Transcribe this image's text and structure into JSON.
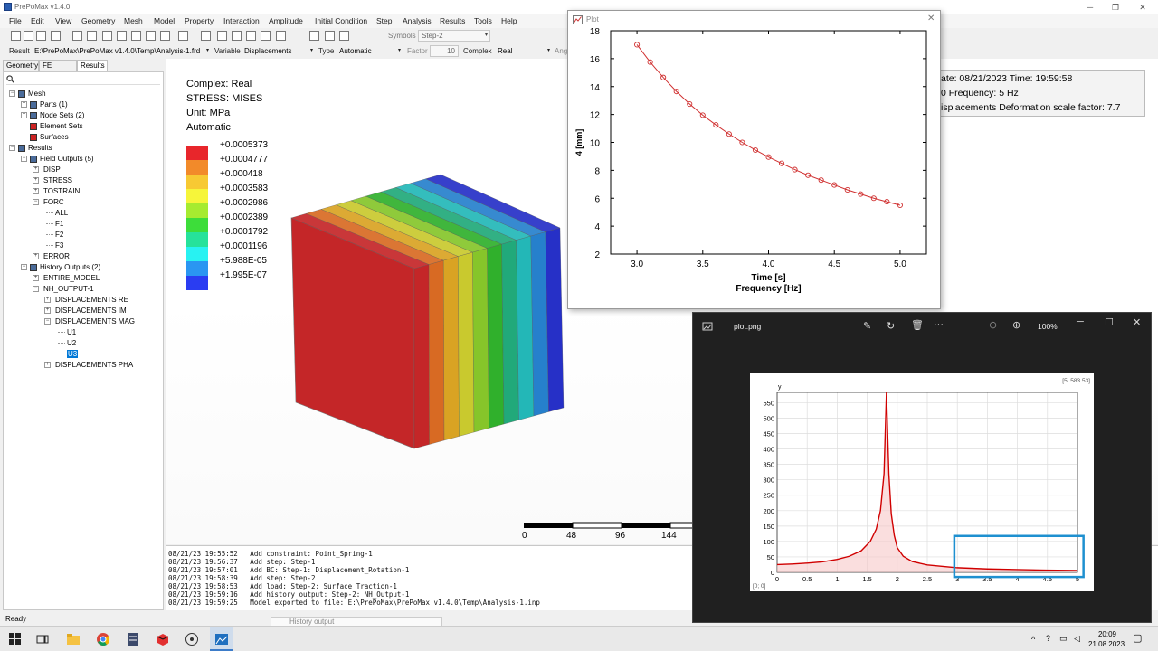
{
  "app": {
    "title": "PrePoMax v1.4.0"
  },
  "menu": [
    "File",
    "Edit",
    "View",
    "Geometry",
    "Mesh",
    "Model",
    "Property",
    "Interaction",
    "Amplitude",
    "Initial Condition",
    "Step",
    "Analysis",
    "Results",
    "Tools",
    "Help"
  ],
  "toolbar": {
    "symbols_label": "Symbols",
    "symbols_value": "Step-2",
    "result_label": "Result",
    "result_path": "E:\\PrePoMax\\PrePoMax v1.4.0\\Temp\\Analysis-1.frd",
    "variable_label": "Variable",
    "variable_value": "Displacements",
    "type_label": "Type",
    "type_value": "Automatic",
    "factor_label": "Factor",
    "factor_value": "10",
    "complex_label": "Complex",
    "complex_value": "Real",
    "angle_label": "Ang"
  },
  "tabs": [
    "Geometry",
    "FE Model",
    "Results"
  ],
  "tree": [
    {
      "label": "Mesh",
      "level": 0,
      "exp": "−"
    },
    {
      "label": "Parts (1)",
      "level": 1,
      "exp": "+"
    },
    {
      "label": "Node Sets (2)",
      "level": 1,
      "exp": "+"
    },
    {
      "label": "Element Sets",
      "level": 1,
      "exp": ""
    },
    {
      "label": "Surfaces",
      "level": 1,
      "exp": ""
    },
    {
      "label": "Results",
      "level": 0,
      "exp": "−"
    },
    {
      "label": "Field Outputs (5)",
      "level": 1,
      "exp": "−"
    },
    {
      "label": "DISP",
      "level": 2,
      "exp": "+"
    },
    {
      "label": "STRESS",
      "level": 2,
      "exp": "+"
    },
    {
      "label": "TOSTRAIN",
      "level": 2,
      "exp": "+"
    },
    {
      "label": "FORC",
      "level": 2,
      "exp": "−"
    },
    {
      "label": "ALL",
      "level": 3,
      "exp": ""
    },
    {
      "label": "F1",
      "level": 3,
      "exp": ""
    },
    {
      "label": "F2",
      "level": 3,
      "exp": ""
    },
    {
      "label": "F3",
      "level": 3,
      "exp": ""
    },
    {
      "label": "ERROR",
      "level": 2,
      "exp": "+"
    },
    {
      "label": "History Outputs (2)",
      "level": 1,
      "exp": "−"
    },
    {
      "label": "ENTIRE_MODEL",
      "level": 2,
      "exp": "+"
    },
    {
      "label": "NH_OUTPUT-1",
      "level": 2,
      "exp": "−"
    },
    {
      "label": "DISPLACEMENTS RE",
      "level": 3,
      "exp": "+"
    },
    {
      "label": "DISPLACEMENTS IM",
      "level": 3,
      "exp": "+"
    },
    {
      "label": "DISPLACEMENTS MAG",
      "level": 3,
      "exp": "−"
    },
    {
      "label": "U1",
      "level": 4,
      "exp": ""
    },
    {
      "label": "U2",
      "level": 4,
      "exp": ""
    },
    {
      "label": "U3",
      "level": 4,
      "exp": "",
      "selected": true
    },
    {
      "label": "DISPLACEMENTS PHA",
      "level": 3,
      "exp": "+"
    }
  ],
  "legend": {
    "complex": "Complex: Real",
    "stress": "STRESS: MISES",
    "unit": "Unit: MPa",
    "mode": "Automatic",
    "values": [
      "+0.0005373",
      "+0.0004777",
      "+0.000418",
      "+0.0003583",
      "+0.0002986",
      "+0.0002389",
      "+0.0001792",
      "+0.0001196",
      "+5.988E-05",
      "+1.995E-07"
    ],
    "colors": [
      "#e8262b",
      "#f28a2a",
      "#f7c933",
      "#f6f53a",
      "#a6eb30",
      "#3ddd3a",
      "#26e29b",
      "#28f2f2",
      "#2a96f2",
      "#2a3df2"
    ]
  },
  "info": {
    "line1": "ate: 08/21/2023   Time: 19:59:58",
    "line2": "0   Frequency: 5 Hz",
    "line3": "isplacements   Deformation scale factor: 7.7"
  },
  "scale_bar": [
    "0",
    "48",
    "96",
    "144"
  ],
  "log": [
    "08/21/23 19:55:52   Add constraint: Point_Spring-1",
    "08/21/23 19:56:37   Add step: Step-1",
    "08/21/23 19:57:01   Add BC: Step-1: Displacement_Rotation-1",
    "08/21/23 19:58:39   Add step: Step-2",
    "08/21/23 19:58:53   Add load: Step-2: Surface_Traction-1",
    "08/21/23 19:59:16   Add history output: Step-2: NH_Output-1",
    "08/21/23 19:59:25   Model exported to file: E:\\PrePoMax\\PrePoMax v1.4.0\\Temp\\Analysis-1.inp"
  ],
  "status": "Ready",
  "history_tab": "History output",
  "plot_window": {
    "title": "Plot"
  },
  "viewer": {
    "file": "plot.png",
    "zoom": "100%",
    "coords_top": "[5; 583.53]",
    "coords_bottom": "[0; 0]",
    "y_label": "y"
  },
  "taskbar": {
    "time": "20:09",
    "date": "21.08.2023"
  },
  "chart_data": [
    {
      "type": "line",
      "title": "",
      "xlabel": "Time [s]",
      "xlabel2": "Frequency [Hz]",
      "ylabel": "4 [mm]",
      "xlim": [
        2.8,
        5.2
      ],
      "ylim": [
        2,
        18
      ],
      "xticks": [
        3.0,
        3.5,
        4.0,
        4.5,
        5.0
      ],
      "yticks": [
        2,
        4,
        6,
        8,
        10,
        12,
        14,
        16,
        18
      ],
      "series": [
        {
          "color": "#d03030",
          "x": [
            3.0,
            3.1,
            3.2,
            3.3,
            3.4,
            3.5,
            3.6,
            3.7,
            3.8,
            3.9,
            4.0,
            4.1,
            4.2,
            4.3,
            4.4,
            4.5,
            4.6,
            4.7,
            4.8,
            4.9,
            5.0
          ],
          "y": [
            17.0,
            15.75,
            14.65,
            13.65,
            12.75,
            11.95,
            11.25,
            10.6,
            10.0,
            9.45,
            8.95,
            8.5,
            8.05,
            7.65,
            7.3,
            6.95,
            6.6,
            6.3,
            6.0,
            5.75,
            5.5
          ]
        }
      ]
    },
    {
      "type": "area",
      "title": "",
      "xlabel": "",
      "ylabel": "y",
      "xlim": [
        0,
        5
      ],
      "ylim": [
        0,
        583.53
      ],
      "xticks": [
        0,
        0.5,
        1,
        1.5,
        2,
        2.5,
        3,
        3.5,
        4,
        4.5,
        5
      ],
      "yticks": [
        0,
        50,
        100,
        150,
        200,
        250,
        300,
        350,
        400,
        450,
        500,
        550
      ],
      "series": [
        {
          "color": "#d00000",
          "x": [
            0,
            0.25,
            0.5,
            0.75,
            1.0,
            1.2,
            1.4,
            1.55,
            1.65,
            1.72,
            1.78,
            1.82,
            1.86,
            1.9,
            1.95,
            2.0,
            2.1,
            2.25,
            2.5,
            3.0,
            3.5,
            4.0,
            4.5,
            5.0
          ],
          "y": [
            25,
            27,
            30,
            34,
            42,
            52,
            70,
            100,
            140,
            200,
            320,
            583.53,
            320,
            190,
            120,
            80,
            52,
            35,
            24,
            15,
            11,
            9,
            7,
            6
          ]
        }
      ],
      "highlight": {
        "x": [
          2.95,
          5.1
        ],
        "y": [
          -15,
          118
        ],
        "color": "#1e90d0"
      }
    }
  ]
}
